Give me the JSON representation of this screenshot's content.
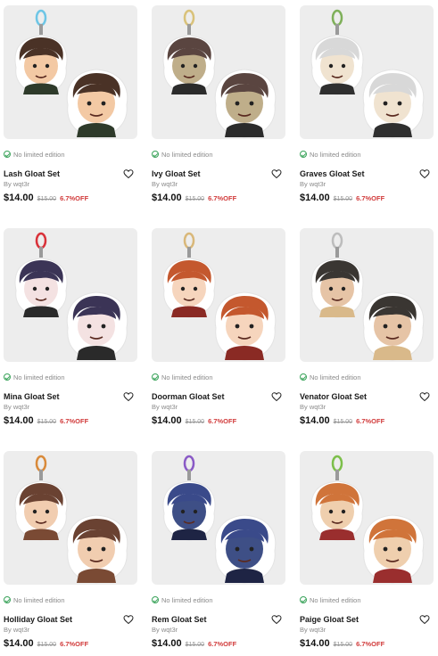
{
  "products": [
    {
      "title": "Lash Gloat Set",
      "limited": "No limited edition",
      "by": "By wqt3r",
      "price": "$14.00",
      "old_price": "$15.00",
      "discount": "6.7%OFF",
      "ring_color": "#6ec6e6",
      "hair_color": "#4a3226",
      "skin_color": "#f3c9a4",
      "accent_color": "#2e3a2a",
      "art_icon": "bearded-man-keychain-art"
    },
    {
      "title": "Ivy Gloat Set",
      "limited": "No limited edition",
      "by": "By wqt3r",
      "price": "$14.00",
      "old_price": "$15.00",
      "discount": "6.7%OFF",
      "ring_color": "#d9c27a",
      "hair_color": "#5a4540",
      "skin_color": "#bfae8a",
      "accent_color": "#2b2b2b",
      "art_icon": "winged-creature-keychain-art"
    },
    {
      "title": "Graves Gloat Set",
      "limited": "No limited edition",
      "by": "By wqt3r",
      "price": "$14.00",
      "old_price": "$15.00",
      "discount": "6.7%OFF",
      "ring_color": "#7fb05a",
      "hair_color": "#d8d8d8",
      "skin_color": "#f0e3d0",
      "accent_color": "#2f2f2f",
      "art_icon": "white-haired-character-keychain-art"
    },
    {
      "title": "Mina Gloat Set",
      "limited": "No limited edition",
      "by": "By wqt3r",
      "price": "$14.00",
      "old_price": "$15.00",
      "discount": "6.7%OFF",
      "ring_color": "#d9323a",
      "hair_color": "#3b3456",
      "skin_color": "#f4e2e2",
      "accent_color": "#2a2a2a",
      "art_icon": "vampire-girl-keychain-art"
    },
    {
      "title": "Doorman Gloat Set",
      "limited": "No limited edition",
      "by": "By wqt3r",
      "price": "$14.00",
      "old_price": "$15.00",
      "discount": "6.7%OFF",
      "ring_color": "#d9b87a",
      "hair_color": "#c4582e",
      "skin_color": "#f6d5bd",
      "accent_color": "#8a2a24",
      "art_icon": "doorman-keychain-art"
    },
    {
      "title": "Venator Gloat Set",
      "limited": "No limited edition",
      "by": "By wqt3r",
      "price": "$14.00",
      "old_price": "$15.00",
      "discount": "6.7%OFF",
      "ring_color": "#bdbdbd",
      "hair_color": "#3a3632",
      "skin_color": "#e6c4a6",
      "accent_color": "#d9b98a",
      "art_icon": "bearded-hunter-keychain-art"
    },
    {
      "title": "Holliday Gloat Set",
      "limited": "No limited edition",
      "by": "By wqt3r",
      "price": "$14.00",
      "old_price": "$15.00",
      "discount": "6.7%OFF",
      "ring_color": "#d98a3a",
      "hair_color": "#6a4232",
      "skin_color": "#f1cdb0",
      "accent_color": "#7a4a34",
      "art_icon": "cowboy-keychain-art"
    },
    {
      "title": "Rem Gloat Set",
      "limited": "No limited edition",
      "by": "By wqt3r",
      "price": "$14.00",
      "old_price": "$15.00",
      "discount": "6.7%OFF",
      "ring_color": "#8a5ac6",
      "hair_color": "#3a4a8a",
      "skin_color": "#3e4f86",
      "accent_color": "#1e2444",
      "art_icon": "wizard-wolf-keychain-art"
    },
    {
      "title": "Paige Gloat Set",
      "limited": "No limited edition",
      "by": "By wqt3r",
      "price": "$14.00",
      "old_price": "$15.00",
      "discount": "6.7%OFF",
      "ring_color": "#7cbf4a",
      "hair_color": "#d0743a",
      "skin_color": "#efcfae",
      "accent_color": "#9a2e2e",
      "art_icon": "reader-keychain-art"
    }
  ]
}
